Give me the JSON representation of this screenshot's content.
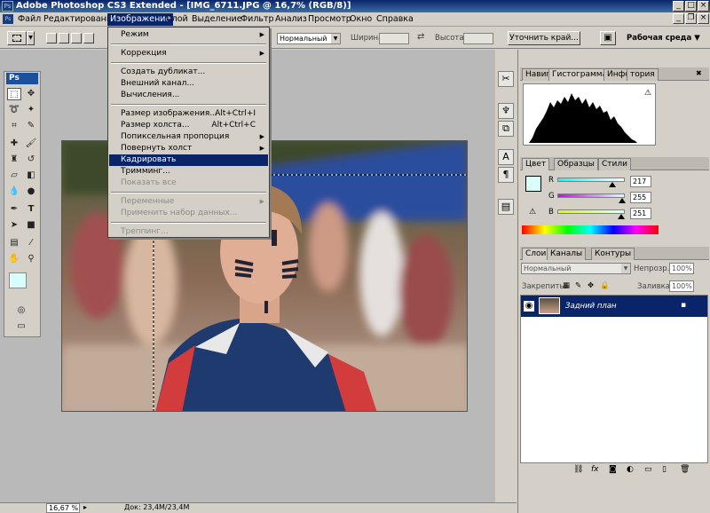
{
  "window": {
    "title": "Adobe Photoshop CS3 Extended - [IMG_6711.JPG @ 16,7% (RGB/8)]",
    "app_icon": "Ps",
    "minimize": "_",
    "maximize": "□",
    "close": "×",
    "doc_minimize": "_",
    "doc_restore": "❐",
    "doc_close": "×"
  },
  "menubar": {
    "items": [
      "Файл",
      "Редактирование",
      "Изображение",
      "Слой",
      "Выделение",
      "Фильтр",
      "Анализ",
      "Просмотр",
      "Окно",
      "Справка"
    ],
    "active": "Изображение"
  },
  "options_bar": {
    "style_value": "Нормальный",
    "width_label": "Ширина:",
    "height_label": "Высота:",
    "refine_edge": "Уточнить край...",
    "workspace": "Рабочая среда"
  },
  "image_menu": {
    "items": [
      {
        "label": "Режим",
        "submenu": true
      },
      {
        "sep": true
      },
      {
        "label": "Коррекция",
        "submenu": true
      },
      {
        "sep": true
      },
      {
        "label": "Создать дубликат..."
      },
      {
        "label": "Внешний канал..."
      },
      {
        "label": "Вычисления..."
      },
      {
        "sep": true
      },
      {
        "label": "Размер изображения...",
        "shortcut": "Alt+Ctrl+I"
      },
      {
        "label": "Размер холста...",
        "shortcut": "Alt+Ctrl+C"
      },
      {
        "label": "Попиксельная пропорция",
        "submenu": true
      },
      {
        "label": "Повернуть холст",
        "submenu": true
      },
      {
        "label": "Кадрировать",
        "highlighted": true
      },
      {
        "label": "Тримминг..."
      },
      {
        "label": "Показать все",
        "disabled": true
      },
      {
        "sep": true
      },
      {
        "label": "Переменные",
        "submenu": true,
        "disabled": true
      },
      {
        "label": "Применить набор данных...",
        "disabled": true
      },
      {
        "sep": true
      },
      {
        "label": "Треппинг...",
        "disabled": true
      }
    ]
  },
  "histogram_panel": {
    "tabs": [
      "Навиг",
      "Гистограмма",
      "Инфо",
      "тория"
    ],
    "active": "Гистограмма",
    "warning": "⚠"
  },
  "color_panel": {
    "tabs": [
      "Цвет",
      "Образцы",
      "Стили"
    ],
    "active": "Цвет",
    "channels": [
      {
        "name": "R",
        "value": "217",
        "fraction": 0.85
      },
      {
        "name": "G",
        "value": "255",
        "fraction": 1.0
      },
      {
        "name": "B",
        "value": "251",
        "fraction": 0.98
      }
    ],
    "fg_color": "#d9fffb"
  },
  "layers_panel": {
    "tabs": [
      "Слои",
      "Каналы",
      "Контуры"
    ],
    "active": "Слои",
    "blend_mode": "Нормальный",
    "opacity_label": "Непрозр.:",
    "opacity_value": "100%",
    "lock_label": "Закрепить:",
    "fill_label": "Заливка:",
    "fill_value": "100%",
    "layers": [
      {
        "name": "Задний план",
        "selected": true
      }
    ]
  },
  "statusbar": {
    "zoom": "16,67 %",
    "doc_info": "Док: 23,4M/23,4M"
  },
  "colors": {
    "menu_highlight": "#0a246a",
    "title_start": "#0a246a",
    "title_end": "#3a6ea5"
  }
}
